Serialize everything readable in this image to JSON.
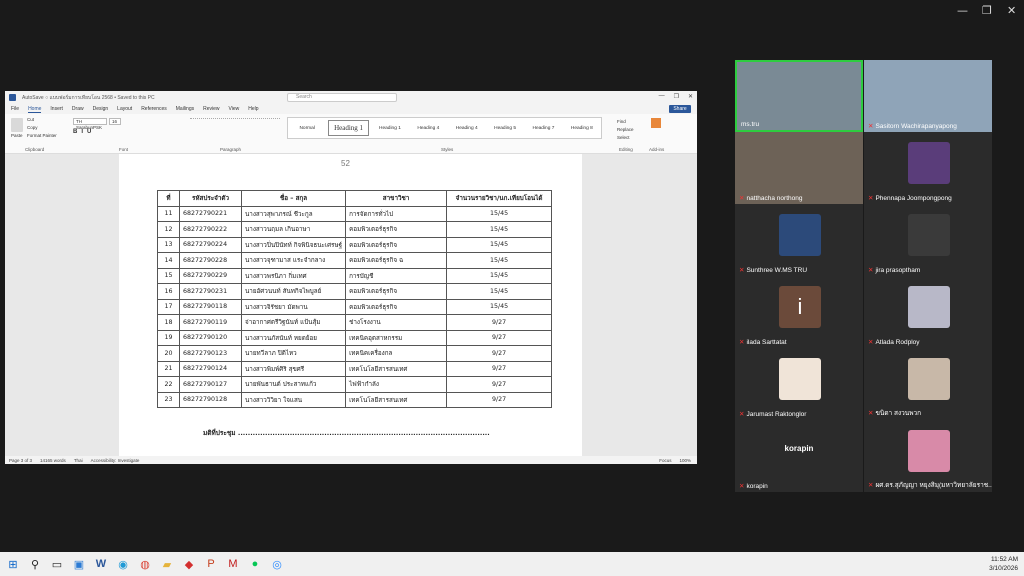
{
  "window_controls": [
    "—",
    "❐",
    "✕"
  ],
  "word": {
    "title": "AutoSave  ○  แบบฟอร์มการเทียบโอน 2568 • Saved to this PC",
    "search_placeholder": "Search",
    "tabs": [
      "File",
      "Home",
      "Insert",
      "Draw",
      "Design",
      "Layout",
      "References",
      "Mailings",
      "Review",
      "View",
      "Help"
    ],
    "active_tab": "Home",
    "share": "Share",
    "font": "TH SarabunPSK",
    "size": "16",
    "groups": {
      "clipboard": "Clipboard",
      "font": "Font",
      "paragraph": "Paragraph",
      "styles": "Styles",
      "editing": "Editing",
      "addins": "Add-ins"
    },
    "clip_items": [
      "Paste",
      "Cut",
      "Copy",
      "Format Painter"
    ],
    "edit_items": [
      "Find",
      "Replace",
      "Select"
    ],
    "styles": [
      "Normal",
      "Heading 1",
      "Heading 1",
      "Heading 4",
      "Heading 4",
      "Heading 5",
      "Heading 7",
      "Heading 8"
    ],
    "page_number": "52",
    "table": {
      "headers": [
        "ที่",
        "รหัสประจำตัว",
        "ชื่อ – สกุล",
        "สาขาวิชา",
        "จำนวนรายวิชา/นก.เทียบโอนได้"
      ],
      "rows": [
        [
          "11",
          "68272790221",
          "นางสาวสุพาภรณ์ ชีวะกูล",
          "การจัดการทั่วไป",
          "15/45"
        ],
        [
          "12",
          "68272790222",
          "นางสาวนฤมล เกินอาษา",
          "คอมพิวเตอร์ธุรกิจ",
          "15/45"
        ],
        [
          "13",
          "68272790224",
          "นางสาวปิ่นปินัทท์ กิจพินิจธนะเศรษฐ์",
          "คอมพิวเตอร์ธุรกิจ",
          "15/45"
        ],
        [
          "14",
          "68272790228",
          "นางสาวจุฑามาส แระจำกลาง",
          "คอมพิวเตอร์ธุรกิจ ฉ",
          "15/45"
        ],
        [
          "15",
          "68272790229",
          "นางสาวพรนิภา กิ่มเทศ",
          "การบัญชี",
          "15/45"
        ],
        [
          "16",
          "68272790231",
          "นายอัศวนนท์ สันทกิจไพบูลย์",
          "คอมพิวเตอร์ธุรกิจ",
          "15/45"
        ],
        [
          "17",
          "68272790118",
          "นางสาวจิรัชยา มัดพาน",
          "คอมพิวเตอร์ธุรกิจ",
          "15/45"
        ],
        [
          "18",
          "68272790119",
          "จ่าอากาศตรีวิฐนันท์ แป้นสุ้ม",
          "ช่างโรงงาน",
          "9/27"
        ],
        [
          "19",
          "68272790120",
          "นางสาวนภัสนันท์ หยดย้อย",
          "เทคนิคอุตสาหกรรม",
          "9/27"
        ],
        [
          "20",
          "68272790123",
          "นายทวีลาภ ปิติไหว",
          "เทคนิคเครื่องกล",
          "9/27"
        ],
        [
          "21",
          "68272790124",
          "นางสาวพิมพ์ศิริ สุขศรี",
          "เทคโนโลยีสารสนเทศ",
          "9/27"
        ],
        [
          "22",
          "68272790127",
          "นายพันธานต์ ประสาทแก้ว",
          "ไฟฟ้ากำลัง",
          "9/27"
        ],
        [
          "23",
          "68272790128",
          "นางสาววิวิยา ใจแสน",
          "เทคโนโลยีสารสนเทศ",
          "9/27"
        ]
      ]
    },
    "sign_line": "มติที่ประชุม ......................................................................................................",
    "status": [
      "Page 3 of 3",
      "14165 words",
      "Thai",
      "Accessibility: Investigate",
      "Focus",
      "100%"
    ]
  },
  "participants": [
    {
      "name": "ms.tru",
      "bg": "#7a8a95"
    },
    {
      "name": "Sasitorn Wachirapanyapong",
      "bg": "#8fa4b8"
    },
    {
      "name": "natthacha northong",
      "bg": "#6d6257"
    },
    {
      "name": "Phennapa Joompongpong",
      "bg": "#2b2b2b"
    },
    {
      "name": "Sunthree W.MS TRU",
      "bg": "#2b2b2b"
    },
    {
      "name": "jira prasoptham",
      "bg": "#2b2b2b"
    },
    {
      "name": "ilada Sarttatat",
      "bg": "#2b2b2b"
    },
    {
      "name": "Atlada Rodploy",
      "bg": "#2b2b2b"
    },
    {
      "name": "Jarumast Raktonglor",
      "bg": "#2b2b2b"
    },
    {
      "name": "ขนิดา สงวนพวก",
      "bg": "#2b2b2b"
    },
    {
      "name": "korapin",
      "bg": "#2b2b2b"
    },
    {
      "name": "ผศ.ดร.สุภัญญา หยุงสิมุ(มหาวิทยาลัยราช...",
      "bg": "#2b2b2b"
    }
  ],
  "korapin_label": "korapin",
  "ilada_initial": "i",
  "taskbar": {
    "time": "11:52 AM",
    "date": "3/10/2026"
  }
}
